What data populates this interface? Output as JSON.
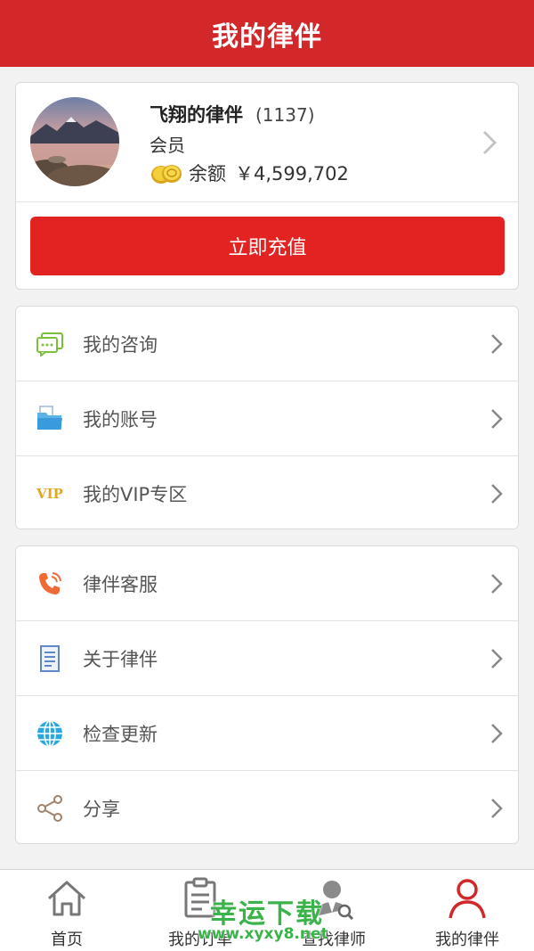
{
  "header": {
    "title": "我的律伴"
  },
  "profile": {
    "name": "飞翔的律伴",
    "id_display": "(1137)",
    "level": "会员",
    "balance_label": "余额",
    "balance_value": "￥4,599,702",
    "recharge_label": "立即充值"
  },
  "menu_group_1": [
    {
      "label": "我的咨询",
      "icon": "chat-icon"
    },
    {
      "label": "我的账号",
      "icon": "folder-icon"
    },
    {
      "label": "我的VIP专区",
      "icon": "vip-icon",
      "icon_text": "VIP"
    }
  ],
  "menu_group_2": [
    {
      "label": "律伴客服",
      "icon": "phone-icon"
    },
    {
      "label": "关于律伴",
      "icon": "document-icon"
    },
    {
      "label": "检查更新",
      "icon": "globe-icon"
    },
    {
      "label": "分享",
      "icon": "share-icon"
    }
  ],
  "tabbar": [
    {
      "label": "首页",
      "icon": "home-icon",
      "active": false
    },
    {
      "label": "我的订单",
      "icon": "clipboard-icon",
      "active": false
    },
    {
      "label": "查找律师",
      "icon": "lawyer-search-icon",
      "active": false
    },
    {
      "label": "我的律伴",
      "icon": "user-icon",
      "active": true
    }
  ],
  "watermark": {
    "title": "幸运下载",
    "url": "www.xyxy8.net"
  },
  "colors": {
    "brand_red": "#d2282a",
    "button_red": "#e32322",
    "active_tab": "#d2282a"
  }
}
